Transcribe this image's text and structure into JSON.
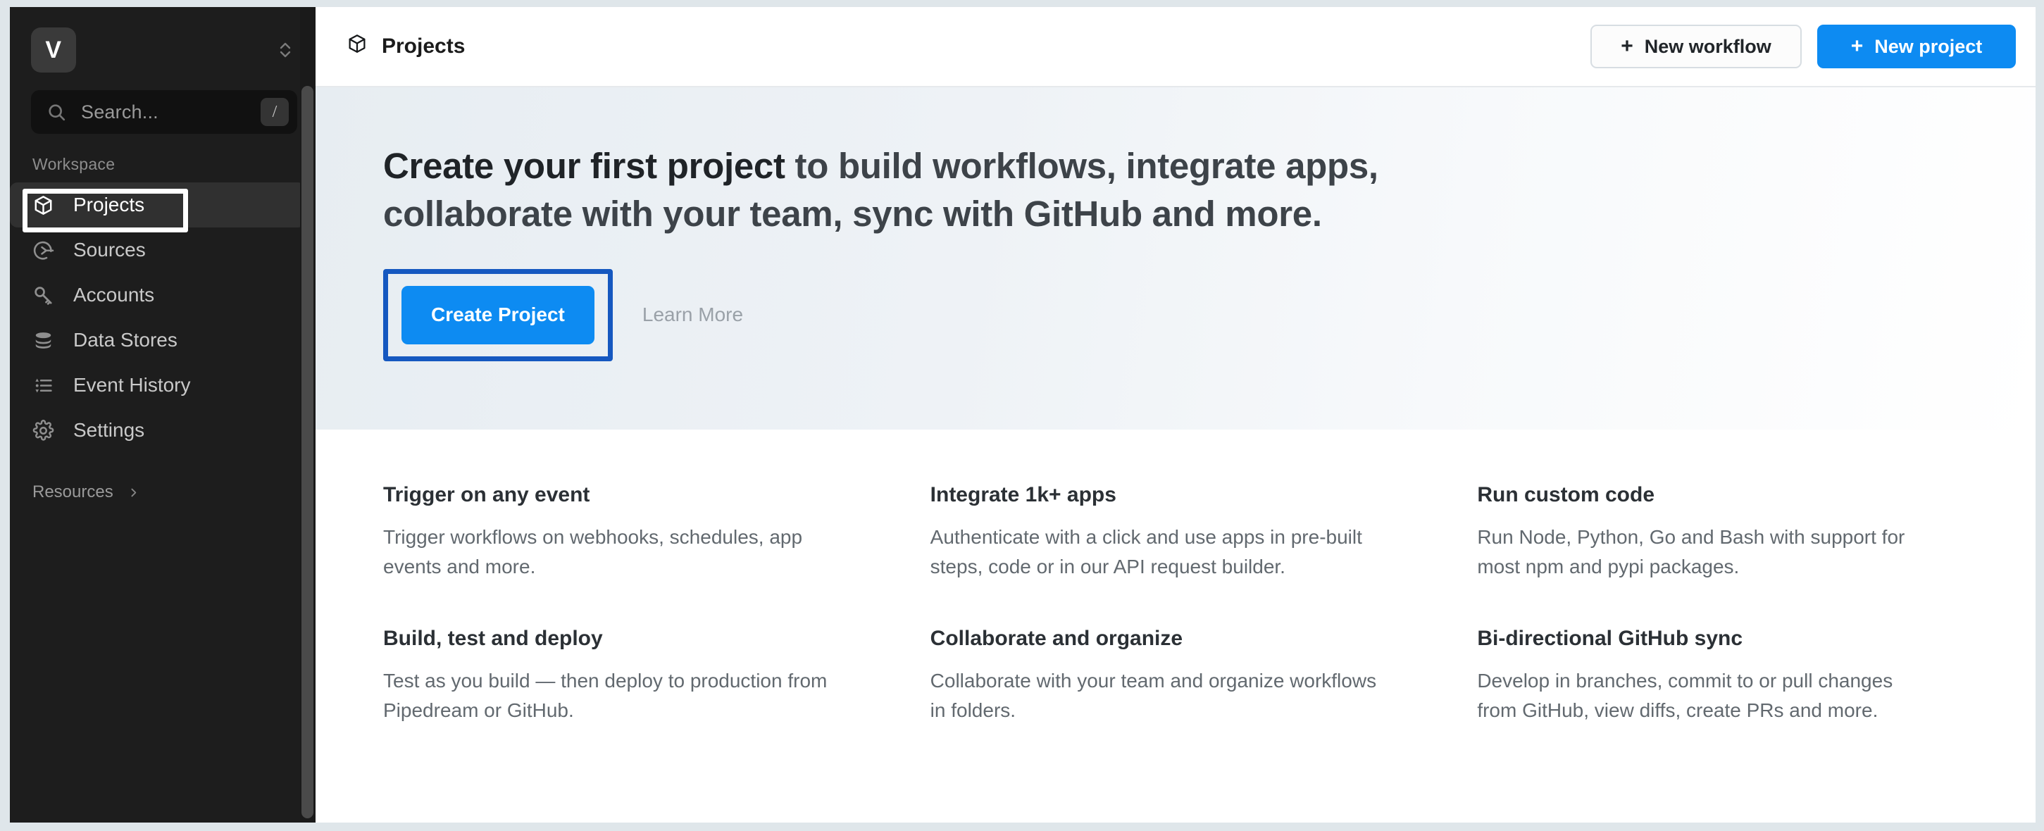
{
  "sidebar": {
    "workspace_avatar_letter": "V",
    "switcher_icon": "chevron-up-down-icon",
    "search": {
      "placeholder": "Search...",
      "shortcut_key": "/",
      "icon": "search-icon"
    },
    "section_label": "Workspace",
    "items": [
      {
        "label": "Projects",
        "icon": "cube-icon",
        "active": true
      },
      {
        "label": "Sources",
        "icon": "source-arrow-icon",
        "active": false
      },
      {
        "label": "Accounts",
        "icon": "key-icon",
        "active": false
      },
      {
        "label": "Data Stores",
        "icon": "database-icon",
        "active": false
      },
      {
        "label": "Event History",
        "icon": "list-icon",
        "active": false
      },
      {
        "label": "Settings",
        "icon": "gear-icon",
        "active": false
      }
    ],
    "resources": {
      "label": "Resources",
      "icon": "chevron-right-icon"
    }
  },
  "topbar": {
    "title": "Projects",
    "title_icon": "cube-icon",
    "new_workflow_label": "New workflow",
    "new_project_label": "New project",
    "plus": "+"
  },
  "hero": {
    "title_bold": "Create your first project",
    "title_rest": " to build workflows, integrate apps, collaborate with your team, sync with GitHub and more.",
    "create_project_label": "Create Project",
    "learn_more_label": "Learn More"
  },
  "features": [
    {
      "title": "Trigger on any event",
      "desc": "Trigger workflows on webhooks, schedules, app events and more."
    },
    {
      "title": "Integrate 1k+ apps",
      "desc": "Authenticate with a click and use apps in pre-built steps, code or in our API request builder."
    },
    {
      "title": "Run custom code",
      "desc": "Run Node, Python, Go and Bash with support for most npm and pypi packages."
    },
    {
      "title": "Build, test and deploy",
      "desc": "Test as you build — then deploy to production from Pipedream or GitHub."
    },
    {
      "title": "Collaborate and organize",
      "desc": "Collaborate with your team and organize workflows in folders."
    },
    {
      "title": "Bi-directional GitHub sync",
      "desc": "Develop in branches, commit to or pull changes from GitHub, view diffs, create PRs and more."
    }
  ],
  "colors": {
    "accent_blue": "#0d8bf2",
    "annotation_blue": "#1558c0",
    "annotation_white": "#ffffff",
    "sidebar_bg": "#1d1d1d"
  }
}
